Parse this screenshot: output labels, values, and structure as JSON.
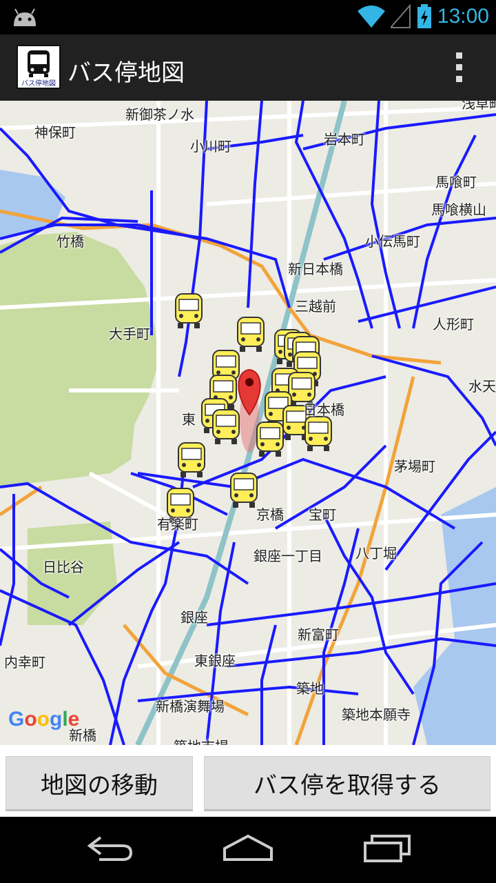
{
  "status_bar": {
    "time": "13:00",
    "icons": [
      "android-icon",
      "wifi-icon",
      "signal-icon",
      "battery-charging-icon"
    ]
  },
  "action_bar": {
    "title": "バス停地図",
    "app_icon_label": "バス停地図",
    "overflow_icon": "overflow-menu-icon"
  },
  "map": {
    "labels": [
      "新御茶ノ水",
      "神保町",
      "小川町",
      "岩本町",
      "浅草町",
      "馬喰町",
      "馬喰横山",
      "竹橋",
      "小伝馬町",
      "新日本橋",
      "三越前",
      "人形町",
      "大手町",
      "水天",
      "東",
      "日本橋",
      "茅場町",
      "有楽町",
      "京橋",
      "宝町",
      "日比谷",
      "銀座一丁目",
      "八丁堀",
      "銀座",
      "新富町",
      "内幸町",
      "東銀座",
      "築地",
      "新橋演舞場",
      "築地本願寺",
      "新橋",
      "築地市場"
    ],
    "attribution": "Google",
    "colors": {
      "bus_route": "#1a1aff",
      "highway": "#f2a33a",
      "park": "#c8dba0",
      "water": "#a8c8ef",
      "rail": "#8ec3c8",
      "marker": "#e53935"
    }
  },
  "buttons": {
    "move_map": "地図の移動",
    "get_stops": "バス停を取得する"
  },
  "nav_bar": {
    "icons": [
      "back-icon",
      "home-icon",
      "recent-apps-icon"
    ]
  }
}
